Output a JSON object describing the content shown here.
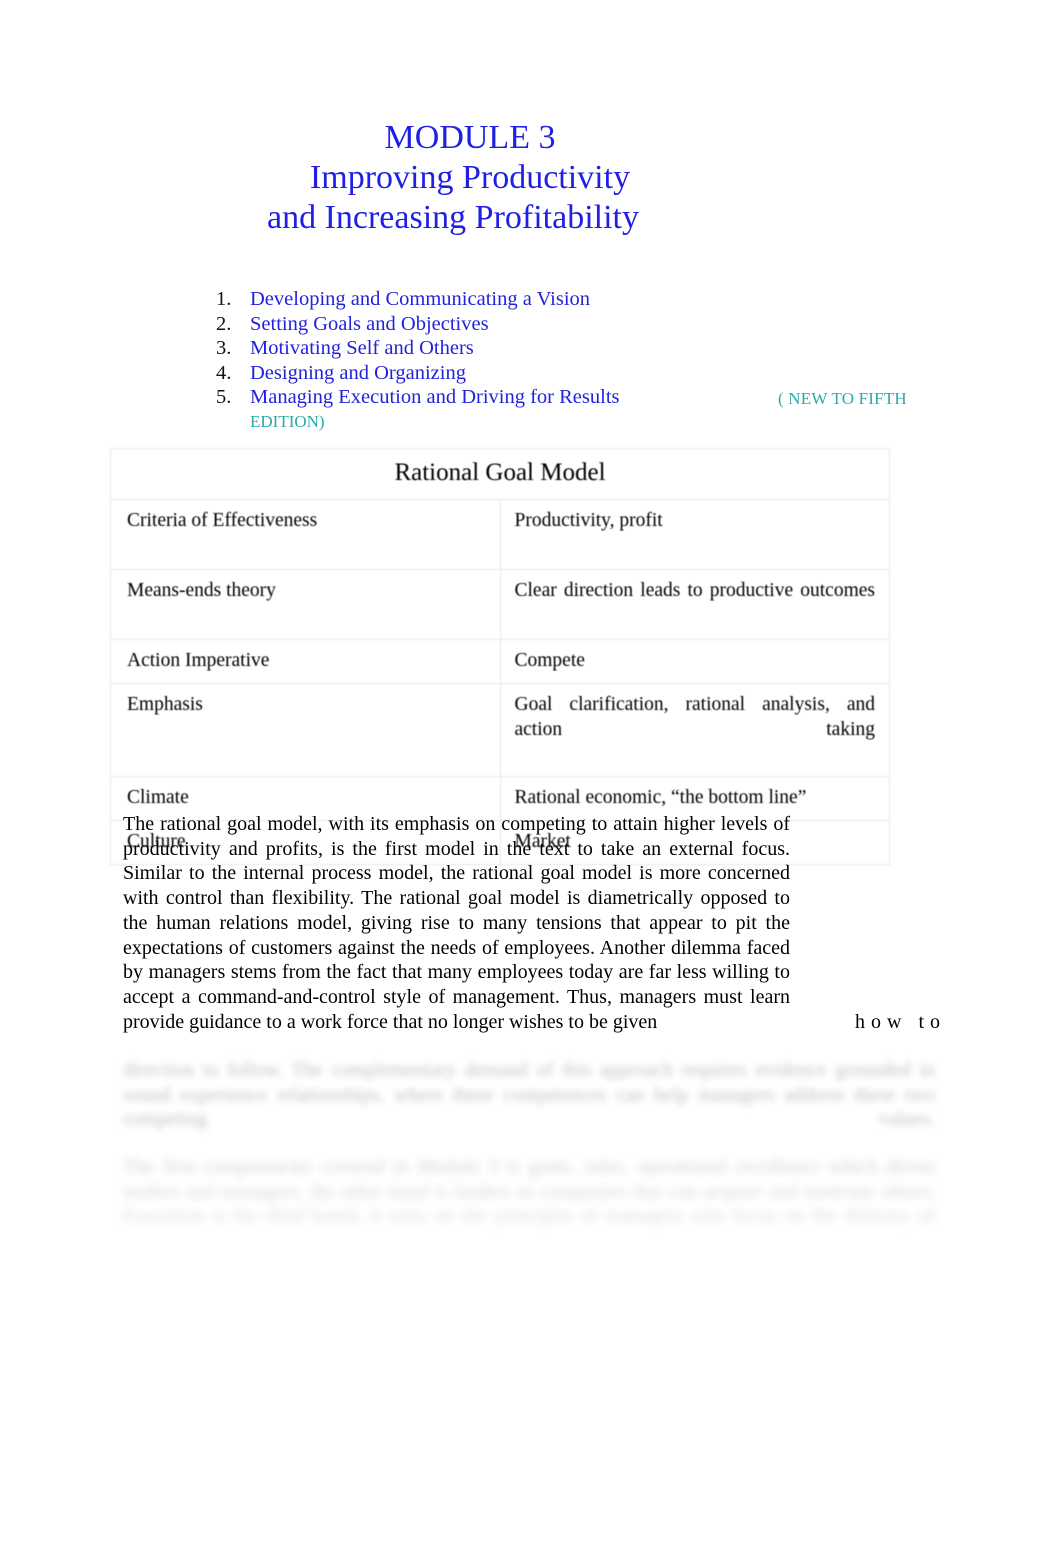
{
  "document": {
    "title_lines": [
      "MODULE 3",
      "Improving Productivity",
      "and Increasing Profitability"
    ],
    "title_color": "#2222dd",
    "note_color": "#2aa9a9"
  },
  "outline": {
    "items": [
      {
        "number": "1.",
        "label": "Developing and Communicating a Vision"
      },
      {
        "number": "2.",
        "label": "Setting Goals and Objectives"
      },
      {
        "number": "3.",
        "label": "Motivating Self and Others"
      },
      {
        "number": "4.",
        "label": "Designing and Organizing"
      },
      {
        "number": "5.",
        "label": "Managing Execution and Driving for Results"
      }
    ],
    "note_part_1": "( NEW TO FIFTH",
    "note_part_2": "EDITION)"
  },
  "table": {
    "header": "Rational Goal Model",
    "rows": [
      {
        "key": "Criteria of Effectiveness",
        "value": "Productivity, profit"
      },
      {
        "key": "Means-ends theory",
        "value": "Clear direction leads to productive outcomes"
      },
      {
        "key": "Action Imperative",
        "value": "Compete"
      },
      {
        "key": "Emphasis",
        "value": "Goal clarification, rational analysis, and action taking"
      },
      {
        "key": "Climate",
        "value": "Rational economic, “the bottom line”"
      },
      {
        "key": "Culture",
        "value": "Market"
      }
    ]
  },
  "body": {
    "paragraph": "The rational goal model, with its emphasis on competing to attain higher levels of productivity and profits, is the first model in the text to take an external focus. Similar to the internal process model, the rational goal model is more concerned with control than flexibility. The rational goal model is diametrically opposed to the human relations model, giving rise to many tensions that appear to pit the expectations of customers against the needs of employees. Another dilemma faced by managers stems from the fact that many employees today are far less willing to accept a command-and-control style of management. Thus, managers must learn",
    "orphan_text": "how to",
    "continuation": "provide guidance to a work force that no longer wishes to be given"
  },
  "obscured": {
    "block_1": "direction to follow. The complementary demand of this approach requires evidence grounded in sound experience relationships, where these competences can help managers address these two competing values.",
    "block_2": "The first competencies covered in Module 3 is goals, roles, operational excellence which drives leaders and managers, the other hand is leaders in companies that can acquire and motivate others. Execution is the third based, it rests on the principles of managers who focus on the delivery of"
  }
}
